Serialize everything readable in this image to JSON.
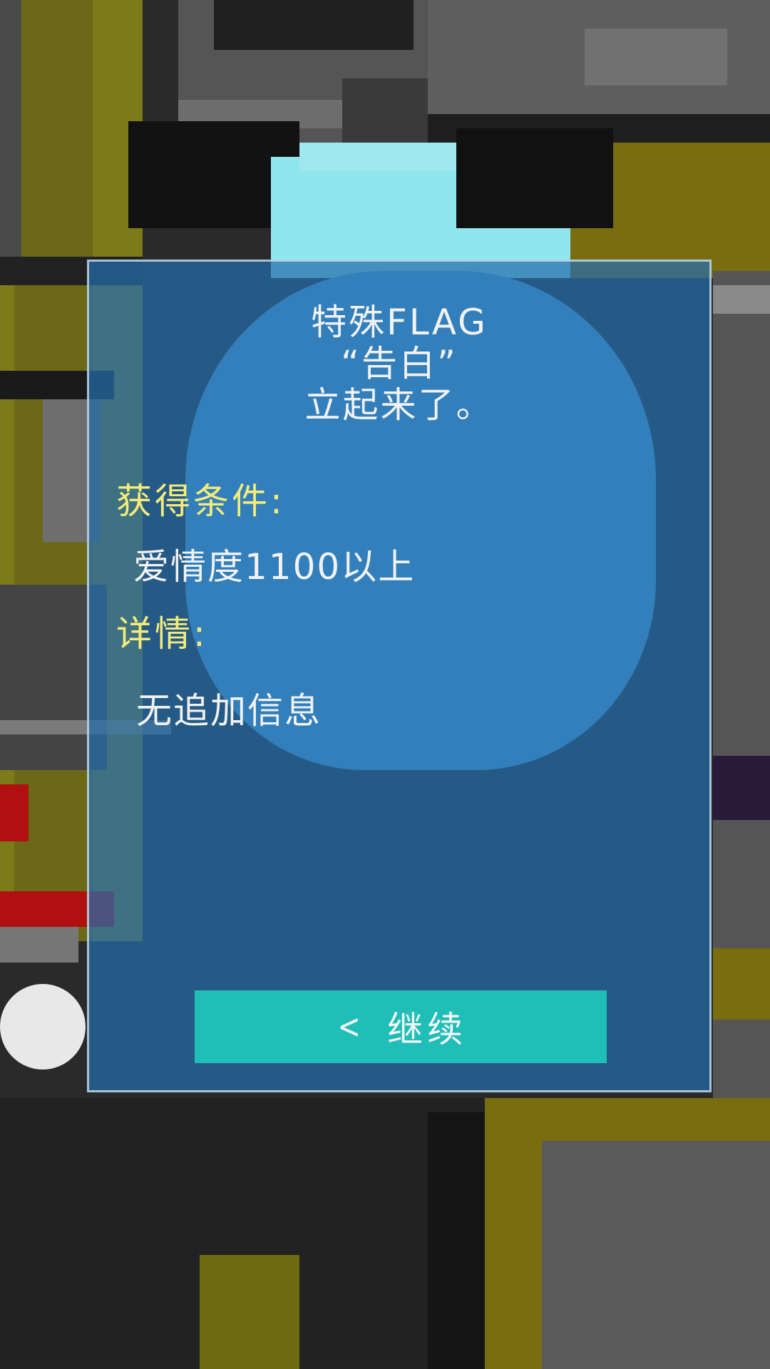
{
  "flag_dialog": {
    "title_line1": "特殊FLAG",
    "title_line2": "“告白”",
    "title_line3": "立起来了。",
    "condition_label": "获得条件:",
    "condition_value": "爱情度1100以上",
    "details_label": "详情:",
    "details_value": "无追加信息",
    "continue_label": "继续",
    "continue_icon": "chevron-left-icon"
  },
  "colors": {
    "panel": "#266eaa",
    "label_yellow": "#f4ec7a",
    "button_teal": "#1fbfb7",
    "text_white": "#f2f2f2"
  }
}
